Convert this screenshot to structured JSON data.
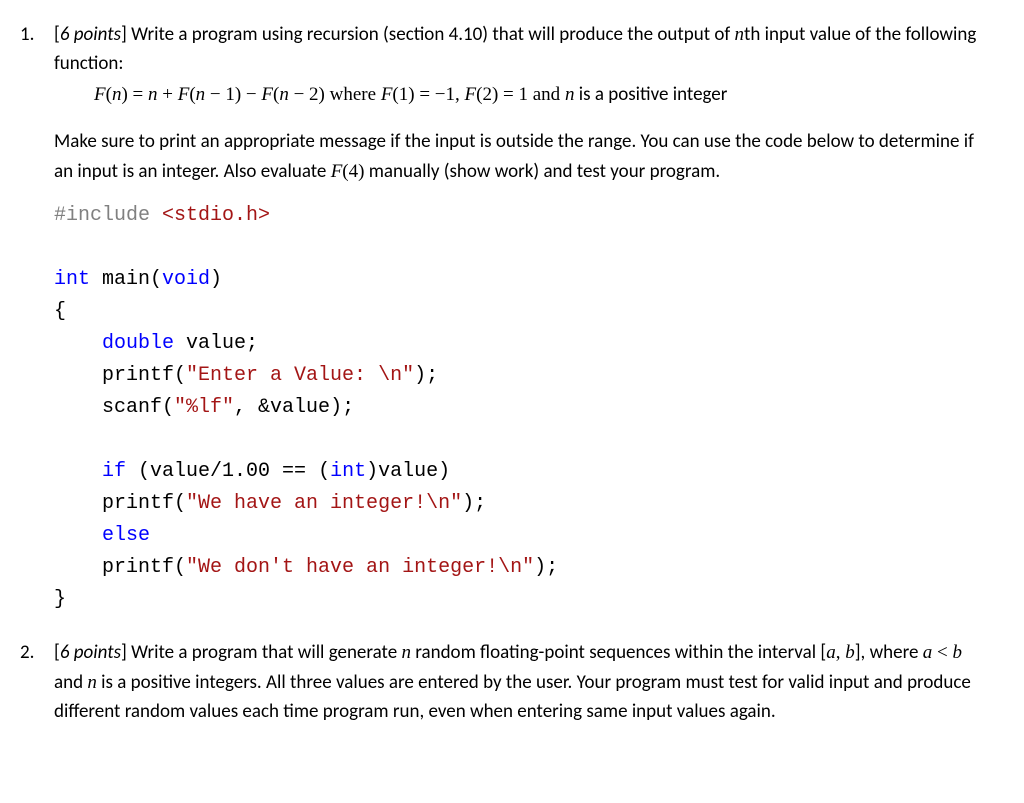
{
  "q1": {
    "number": "1.",
    "points_open": "[",
    "points_text": "6 points",
    "points_close": "]",
    "intro_a": " Write a program using recursion (section 4.10) that will produce the output of ",
    "intro_n": "n",
    "intro_b": "th input value of the following function:",
    "formula": {
      "f1": "F",
      "p1": "(",
      "n1": "n",
      "p2": ") = ",
      "n2": "n",
      "p3": " + ",
      "f2": "F",
      "p4": "(",
      "n3": "n",
      "p5": " − 1) − ",
      "f3": "F",
      "p6": "(",
      "n4": "n",
      "p7": " − 2) where ",
      "f4": "F",
      "p8": "(1) = −1,  ",
      "f5": "F",
      "p9": "(2) = 1 and  ",
      "n5": "n",
      "p10": " is a positive integer"
    },
    "para2_a": "Make sure to print an appropriate message if the input is outside the range.  You can use the code below to determine if an input is an integer.  Also evaluate ",
    "para2_f": "F",
    "para2_p": "(4)",
    "para2_b": " manually (show work) and test your program.",
    "code": {
      "include": "#include",
      "stdio": " <stdio.h>",
      "int": "int",
      "main": " main(",
      "void": "void",
      "main_close": ")",
      "brace_open": "{",
      "double": "double",
      "value_decl": " value;",
      "printf1a": "printf(",
      "str1": "\"Enter a Value: \\n\"",
      "printf1b": ");",
      "scanf_a": "scanf(",
      "str2": "\"%lf\"",
      "scanf_b": ", &value);",
      "if": "if",
      "if_cond": " (value/1.00 == (",
      "int_cast": "int",
      "if_cond2": ")value)",
      "printf2a": "printf(",
      "str3": "\"We have an integer!\\n\"",
      "printf2b": ");",
      "else": "else",
      "printf3a": "printf(",
      "str4": "\"We don't have an integer!\\n\"",
      "printf3b": ");",
      "brace_close": "}"
    }
  },
  "q2": {
    "number": "2.",
    "points_open": "[",
    "points_text": "6 points",
    "points_close": "]",
    "text_a": " Write a program that will generate ",
    "n1": "n",
    "text_b": " random floating-point sequences within the interval [",
    "a": "a",
    "comma": ", ",
    "b": "b",
    "text_c": "], where ",
    "a2": "a",
    "lt": " < ",
    "b2": "b",
    "text_d": "  and ",
    "n2": "n",
    "text_e": " is a positive integers.  All three values are entered by the user.  Your program must test for valid input and produce different random values each time program run, even when entering same input values again."
  }
}
